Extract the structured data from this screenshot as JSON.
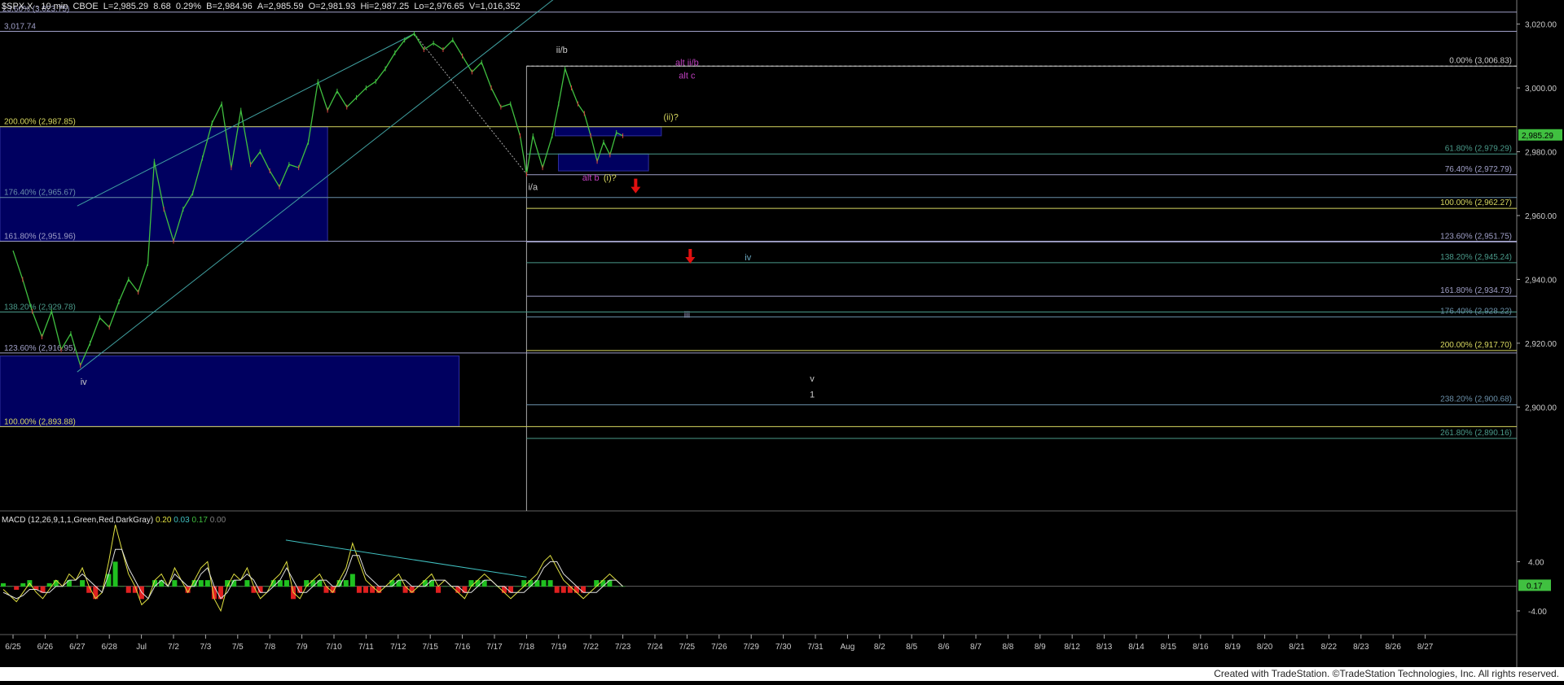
{
  "header": {
    "symbol": "$SPX.X",
    "interval": "10 min",
    "exchange": "CBOE",
    "last": "L=2,985.29",
    "change": "8.68",
    "change_pct": "0.29%",
    "bid": "B=2,984.96",
    "ask": "A=2,985.59",
    "open": "O=2,981.93",
    "high": "Hi=2,987.25",
    "low": "Lo=2,976.65",
    "volume": "V=1,016,352"
  },
  "chart_data": {
    "type": "line",
    "title": "$SPX.X - 10 min",
    "price_axis": {
      "ticks": [
        3020,
        3000,
        2980,
        2960,
        2940,
        2920,
        2900
      ],
      "tick_labels": [
        "3,020.00",
        "3,000.00",
        "2,980.00",
        "2,960.00",
        "2,940.00",
        "2,920.00",
        "2,900.00"
      ],
      "last_price_label": "2,985.29",
      "ylim": [
        2870,
        3025
      ]
    },
    "date_axis": [
      "6/25",
      "6/26",
      "6/27",
      "6/28",
      "Jul",
      "7/2",
      "7/3",
      "7/5",
      "7/8",
      "7/9",
      "7/10",
      "7/11",
      "7/12",
      "7/15",
      "7/16",
      "7/17",
      "7/18",
      "7/19",
      "7/22",
      "7/23",
      "7/24",
      "7/25",
      "7/26",
      "7/29",
      "7/30",
      "7/31",
      "Aug",
      "8/2",
      "8/5",
      "8/6",
      "8/7",
      "8/8",
      "8/9",
      "8/12",
      "8/13",
      "8/14",
      "8/15",
      "8/16",
      "8/19",
      "8/20",
      "8/21",
      "8/22",
      "8/23",
      "8/26",
      "8/27"
    ],
    "price_series": [
      {
        "d": 0,
        "p": 2949
      },
      {
        "d": 0.3,
        "p": 2940
      },
      {
        "d": 0.6,
        "p": 2930
      },
      {
        "d": 0.9,
        "p": 2922
      },
      {
        "d": 1.2,
        "p": 2930
      },
      {
        "d": 1.5,
        "p": 2918
      },
      {
        "d": 1.8,
        "p": 2923
      },
      {
        "d": 2.1,
        "p": 2913
      },
      {
        "d": 2.4,
        "p": 2920
      },
      {
        "d": 2.7,
        "p": 2928
      },
      {
        "d": 3.0,
        "p": 2925
      },
      {
        "d": 3.3,
        "p": 2933
      },
      {
        "d": 3.6,
        "p": 2940
      },
      {
        "d": 3.9,
        "p": 2936
      },
      {
        "d": 4.2,
        "p": 2945
      },
      {
        "d": 4.4,
        "p": 2977
      },
      {
        "d": 4.7,
        "p": 2962
      },
      {
        "d": 5.0,
        "p": 2952
      },
      {
        "d": 5.3,
        "p": 2962
      },
      {
        "d": 5.6,
        "p": 2967
      },
      {
        "d": 5.9,
        "p": 2978
      },
      {
        "d": 6.2,
        "p": 2989
      },
      {
        "d": 6.5,
        "p": 2995
      },
      {
        "d": 6.8,
        "p": 2975
      },
      {
        "d": 7.1,
        "p": 2993
      },
      {
        "d": 7.4,
        "p": 2976
      },
      {
        "d": 7.7,
        "p": 2980
      },
      {
        "d": 8.0,
        "p": 2974
      },
      {
        "d": 8.3,
        "p": 2969
      },
      {
        "d": 8.6,
        "p": 2976
      },
      {
        "d": 8.9,
        "p": 2975
      },
      {
        "d": 9.2,
        "p": 2983
      },
      {
        "d": 9.5,
        "p": 3002
      },
      {
        "d": 9.8,
        "p": 2993
      },
      {
        "d": 10.1,
        "p": 2999
      },
      {
        "d": 10.4,
        "p": 2994
      },
      {
        "d": 10.7,
        "p": 2997
      },
      {
        "d": 11.0,
        "p": 3000
      },
      {
        "d": 11.3,
        "p": 3002
      },
      {
        "d": 11.6,
        "p": 3006
      },
      {
        "d": 11.9,
        "p": 3011
      },
      {
        "d": 12.2,
        "p": 3015
      },
      {
        "d": 12.5,
        "p": 3017
      },
      {
        "d": 12.8,
        "p": 3012
      },
      {
        "d": 13.1,
        "p": 3014
      },
      {
        "d": 13.4,
        "p": 3012
      },
      {
        "d": 13.7,
        "p": 3015
      },
      {
        "d": 14.0,
        "p": 3010
      },
      {
        "d": 14.3,
        "p": 3005
      },
      {
        "d": 14.6,
        "p": 3008
      },
      {
        "d": 14.9,
        "p": 3000
      },
      {
        "d": 15.2,
        "p": 2994
      },
      {
        "d": 15.5,
        "p": 2995
      },
      {
        "d": 15.8,
        "p": 2985
      },
      {
        "d": 16.0,
        "p": 2973
      },
      {
        "d": 16.2,
        "p": 2985
      },
      {
        "d": 16.5,
        "p": 2975
      },
      {
        "d": 16.8,
        "p": 2985
      },
      {
        "d": 17.0,
        "p": 2995
      },
      {
        "d": 17.2,
        "p": 3006
      },
      {
        "d": 17.4,
        "p": 3000
      },
      {
        "d": 17.6,
        "p": 2995
      },
      {
        "d": 17.8,
        "p": 2992
      },
      {
        "d": 18.0,
        "p": 2985
      },
      {
        "d": 18.2,
        "p": 2977
      },
      {
        "d": 18.4,
        "p": 2983
      },
      {
        "d": 18.6,
        "p": 2979
      },
      {
        "d": 18.8,
        "p": 2986
      },
      {
        "d": 19.0,
        "p": 2985
      }
    ],
    "shaded_zones": [
      {
        "d0": 0,
        "d1": 9.8,
        "p0": 2951.96,
        "p1": 2987.85
      },
      {
        "d0": 0,
        "d1": 13.9,
        "p0": 2893.88,
        "p1": 2916
      },
      {
        "d0": 17.3,
        "d1": 20.2,
        "p0": 2985,
        "p1": 2987.85
      },
      {
        "d0": 17.4,
        "d1": 19.8,
        "p0": 2974,
        "p1": 2979.3
      }
    ],
    "levels_left": [
      {
        "label": "3,017.74",
        "price": 3017.74,
        "color": "#a0a0c8"
      },
      {
        "label": "200.00% (2,987.85)",
        "price": 2987.85,
        "color": "#d8d860"
      },
      {
        "label": "176.40% (2,965.67)",
        "price": 2965.67,
        "color": "#6a8fa8"
      },
      {
        "label": "161.80% (2,951.96)",
        "price": 2951.96,
        "color": "#a0a0c8"
      },
      {
        "label": "138.20% (2,929.78)",
        "price": 2929.78,
        "color": "#4a9a8a"
      },
      {
        "label": "123.60% (2,916.95)",
        "price": 2916.95,
        "color": "#a0a0c8"
      },
      {
        "label": "100.00% (2,893.88)",
        "price": 2893.88,
        "color": "#d8d860"
      }
    ],
    "levels_right": [
      {
        "label": "0.00% (3,006.83)",
        "price": 3006.83,
        "color": "#cccccc"
      },
      {
        "label": "61.80% (2,979.29)",
        "price": 2979.29,
        "color": "#4a9a8a"
      },
      {
        "label": "76.40% (2,972.79)",
        "price": 2972.79,
        "color": "#a0a0c8"
      },
      {
        "label": "100.00% (2,962.27)",
        "price": 2962.27,
        "color": "#d8d860"
      },
      {
        "label": "123.60% (2,951.75)",
        "price": 2951.75,
        "color": "#a0a0c8"
      },
      {
        "label": "138.20% (2,945.24)",
        "price": 2945.24,
        "color": "#4a9a8a"
      },
      {
        "label": "161.80% (2,934.73)",
        "price": 2934.73,
        "color": "#a0a0c8"
      },
      {
        "label": "176.40% (2,928.22)",
        "price": 2928.22,
        "color": "#6a8fa8"
      },
      {
        "label": "200.00% (2,917.70)",
        "price": 2917.7,
        "color": "#d8d860"
      },
      {
        "label": "238.20% (2,900.68)",
        "price": 2900.68,
        "color": "#6a8fa8"
      },
      {
        "label": "261.80% (2,890.16)",
        "price": 2890.16,
        "color": "#4a9a8a"
      }
    ],
    "top_label": "23.60% (3,023.75)",
    "wave_labels": [
      {
        "text": "ii/b",
        "d": 17.1,
        "p": 3011,
        "color": "#cccccc"
      },
      {
        "text": "i/a",
        "d": 16.2,
        "p": 2968,
        "color": "#cccccc"
      },
      {
        "text": "alt b",
        "d": 18.0,
        "p": 2971,
        "color": "#c040c0"
      },
      {
        "text": "(i)?",
        "d": 18.6,
        "p": 2971,
        "color": "#d8d860"
      },
      {
        "text": "(ii)?",
        "d": 20.5,
        "p": 2990,
        "color": "#d8d860"
      },
      {
        "text": "alt ii/b",
        "d": 21.0,
        "p": 3007,
        "color": "#c040c0"
      },
      {
        "text": "alt c",
        "d": 21.0,
        "p": 3003,
        "color": "#c040c0"
      },
      {
        "text": "iv",
        "d": 22.9,
        "p": 2946,
        "color": "#6aa8c0"
      },
      {
        "text": "iii",
        "d": 21.0,
        "p": 2928,
        "color": "#a0a0c8"
      },
      {
        "text": "v",
        "d": 24.9,
        "p": 2908,
        "color": "#cccccc"
      },
      {
        "text": "1",
        "d": 24.9,
        "p": 2903,
        "color": "#cccccc"
      },
      {
        "text": "iv",
        "d": 2.2,
        "p": 2907,
        "color": "#cccccc"
      }
    ],
    "arrows": [
      {
        "d": 19.4,
        "p": 2969
      },
      {
        "d": 21.1,
        "p": 2947
      }
    ]
  },
  "macd": {
    "title": "MACD (12,26,9,1,1,Green,Red,DarkGray)",
    "v1": "0.20",
    "v2": "0.03",
    "v3": "0.17",
    "v4": "0.00",
    "tick_labels": [
      "4.00",
      "-4.00"
    ],
    "ticks": [
      4,
      -4
    ],
    "last_label": "0.17",
    "ylim": [
      -8.5,
      10
    ],
    "macd_line": [
      -0.5,
      -1.5,
      -2.5,
      -1,
      0.5,
      -1,
      -2,
      -0.5,
      1,
      0,
      2,
      1,
      3,
      0,
      -2,
      -1,
      4,
      10,
      6,
      2,
      0,
      -3,
      -2,
      1,
      2,
      0,
      3,
      1,
      -1,
      1,
      3,
      4,
      -2,
      -4,
      0,
      2,
      1,
      3,
      0,
      -2,
      -1,
      1,
      2,
      4,
      -1,
      -2,
      0,
      1,
      2,
      0,
      -1,
      1,
      3,
      7,
      4,
      1,
      0,
      -1,
      0,
      1,
      2,
      0,
      -1,
      0,
      1,
      2,
      0,
      1,
      0,
      -1,
      -2,
      0,
      1,
      2,
      1,
      0,
      -1,
      -2,
      -1,
      0,
      1,
      2,
      4,
      5,
      3,
      1,
      0,
      -1,
      -2,
      -1,
      0,
      1,
      2,
      1,
      0
    ],
    "signal_line": [
      -1,
      -1.5,
      -2,
      -1.5,
      -0.5,
      -0.5,
      -1,
      -1,
      0,
      0,
      1,
      1,
      2,
      1,
      0,
      -1,
      2,
      6,
      6,
      3,
      1,
      -1,
      -2,
      0,
      1,
      0,
      2,
      1,
      0,
      0,
      2,
      3,
      0,
      -2,
      -1,
      1,
      1,
      2,
      1,
      -1,
      -1,
      0,
      1,
      3,
      1,
      -1,
      -1,
      0,
      1,
      1,
      0,
      0,
      2,
      5,
      5,
      2,
      1,
      0,
      0,
      0,
      1,
      1,
      0,
      0,
      0,
      1,
      1,
      1,
      0,
      0,
      -1,
      -1,
      0,
      1,
      1,
      0,
      0,
      -1,
      -1,
      -1,
      0,
      1,
      3,
      4,
      4,
      2,
      1,
      0,
      -1,
      -1,
      -1,
      0,
      1,
      1,
      0
    ],
    "trendline": [
      {
        "d": 8.5,
        "v": 7.5
      },
      {
        "d": 16.0,
        "v": 1.5
      }
    ]
  },
  "footer": "Created with TradeStation. ©TradeStation Technologies, Inc. All rights reserved."
}
